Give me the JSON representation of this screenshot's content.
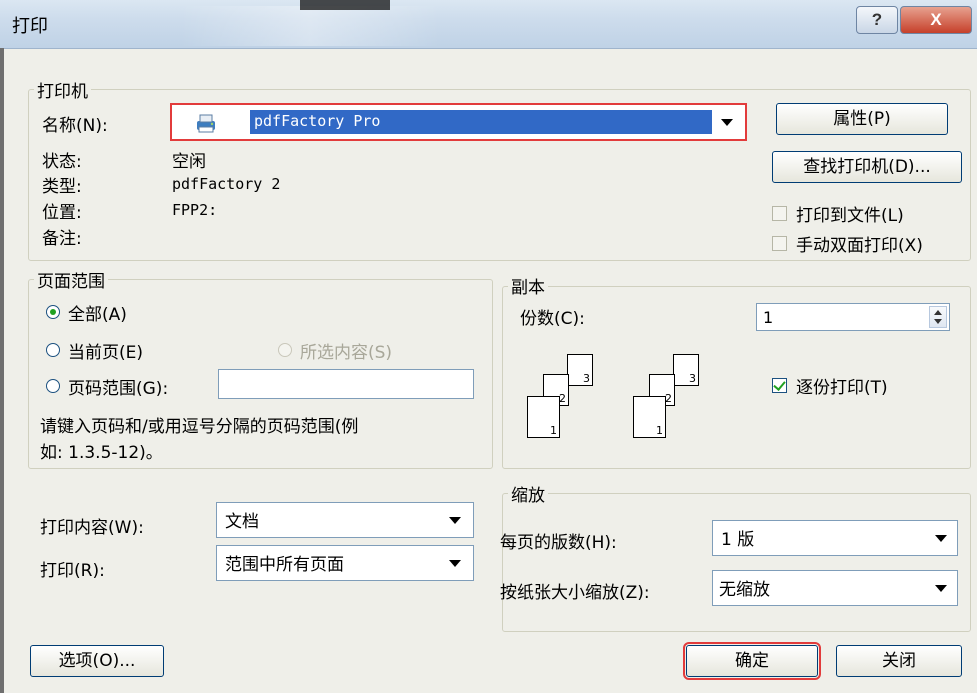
{
  "window": {
    "title": "打印",
    "help_label": "?",
    "close_label": "X"
  },
  "printer": {
    "group_title": "打印机",
    "name_label": "名称(N):",
    "name_value": "pdfFactory Pro",
    "status_label": "状态:",
    "status_value": "空闲",
    "type_label": "类型:",
    "type_value": "pdfFactory 2",
    "location_label": "位置:",
    "location_value": "FPP2:",
    "comment_label": "备注:",
    "properties_button": "属性(P)",
    "find_printer_button": "查找打印机(D)...",
    "print_to_file_label": "打印到文件(L)",
    "print_to_file_checked": false,
    "manual_duplex_label": "手动双面打印(X)",
    "manual_duplex_checked": false
  },
  "page_range": {
    "group_title": "页面范围",
    "all_label": "全部(A)",
    "current_label": "当前页(E)",
    "selection_label": "所选内容(S)",
    "pages_label": "页码范围(G):",
    "pages_value": "",
    "selected": "all",
    "hint_line1": "请键入页码和/或用逗号分隔的页码范围(例",
    "hint_line2": "如: 1.3.5-12)。"
  },
  "copies": {
    "group_title": "副本",
    "count_label": "份数(C):",
    "count_value": "1",
    "collate_label": "逐份打印(T)",
    "collate_checked": true,
    "stack1": [
      "1",
      "2",
      "3"
    ],
    "stack2": [
      "1",
      "2",
      "3"
    ]
  },
  "print_what": {
    "label": "打印内容(W):",
    "value": "文档"
  },
  "print": {
    "label": "打印(R):",
    "value": "范围中所有页面"
  },
  "zoom": {
    "group_title": "缩放",
    "pages_per_sheet_label": "每页的版数(H):",
    "pages_per_sheet_value": "1 版",
    "scale_label": "按纸张大小缩放(Z):",
    "scale_value": "无缩放"
  },
  "footer": {
    "options_button": "选项(O)...",
    "ok_button": "确定",
    "close_button": "关闭"
  }
}
